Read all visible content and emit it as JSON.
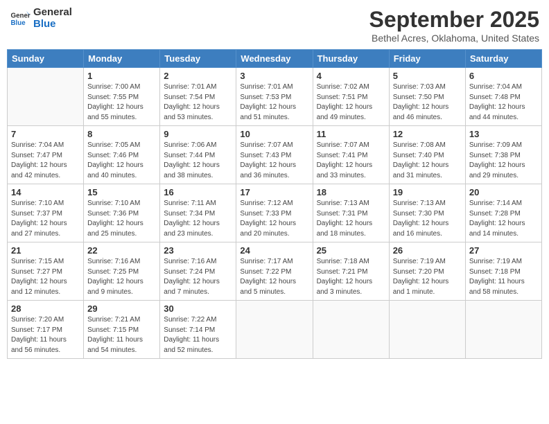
{
  "logo": {
    "line1": "General",
    "line2": "Blue"
  },
  "title": "September 2025",
  "location": "Bethel Acres, Oklahoma, United States",
  "days_of_week": [
    "Sunday",
    "Monday",
    "Tuesday",
    "Wednesday",
    "Thursday",
    "Friday",
    "Saturday"
  ],
  "weeks": [
    [
      {
        "day": "",
        "info": ""
      },
      {
        "day": "1",
        "info": "Sunrise: 7:00 AM\nSunset: 7:55 PM\nDaylight: 12 hours\nand 55 minutes."
      },
      {
        "day": "2",
        "info": "Sunrise: 7:01 AM\nSunset: 7:54 PM\nDaylight: 12 hours\nand 53 minutes."
      },
      {
        "day": "3",
        "info": "Sunrise: 7:01 AM\nSunset: 7:53 PM\nDaylight: 12 hours\nand 51 minutes."
      },
      {
        "day": "4",
        "info": "Sunrise: 7:02 AM\nSunset: 7:51 PM\nDaylight: 12 hours\nand 49 minutes."
      },
      {
        "day": "5",
        "info": "Sunrise: 7:03 AM\nSunset: 7:50 PM\nDaylight: 12 hours\nand 46 minutes."
      },
      {
        "day": "6",
        "info": "Sunrise: 7:04 AM\nSunset: 7:48 PM\nDaylight: 12 hours\nand 44 minutes."
      }
    ],
    [
      {
        "day": "7",
        "info": "Sunrise: 7:04 AM\nSunset: 7:47 PM\nDaylight: 12 hours\nand 42 minutes."
      },
      {
        "day": "8",
        "info": "Sunrise: 7:05 AM\nSunset: 7:46 PM\nDaylight: 12 hours\nand 40 minutes."
      },
      {
        "day": "9",
        "info": "Sunrise: 7:06 AM\nSunset: 7:44 PM\nDaylight: 12 hours\nand 38 minutes."
      },
      {
        "day": "10",
        "info": "Sunrise: 7:07 AM\nSunset: 7:43 PM\nDaylight: 12 hours\nand 36 minutes."
      },
      {
        "day": "11",
        "info": "Sunrise: 7:07 AM\nSunset: 7:41 PM\nDaylight: 12 hours\nand 33 minutes."
      },
      {
        "day": "12",
        "info": "Sunrise: 7:08 AM\nSunset: 7:40 PM\nDaylight: 12 hours\nand 31 minutes."
      },
      {
        "day": "13",
        "info": "Sunrise: 7:09 AM\nSunset: 7:38 PM\nDaylight: 12 hours\nand 29 minutes."
      }
    ],
    [
      {
        "day": "14",
        "info": "Sunrise: 7:10 AM\nSunset: 7:37 PM\nDaylight: 12 hours\nand 27 minutes."
      },
      {
        "day": "15",
        "info": "Sunrise: 7:10 AM\nSunset: 7:36 PM\nDaylight: 12 hours\nand 25 minutes."
      },
      {
        "day": "16",
        "info": "Sunrise: 7:11 AM\nSunset: 7:34 PM\nDaylight: 12 hours\nand 23 minutes."
      },
      {
        "day": "17",
        "info": "Sunrise: 7:12 AM\nSunset: 7:33 PM\nDaylight: 12 hours\nand 20 minutes."
      },
      {
        "day": "18",
        "info": "Sunrise: 7:13 AM\nSunset: 7:31 PM\nDaylight: 12 hours\nand 18 minutes."
      },
      {
        "day": "19",
        "info": "Sunrise: 7:13 AM\nSunset: 7:30 PM\nDaylight: 12 hours\nand 16 minutes."
      },
      {
        "day": "20",
        "info": "Sunrise: 7:14 AM\nSunset: 7:28 PM\nDaylight: 12 hours\nand 14 minutes."
      }
    ],
    [
      {
        "day": "21",
        "info": "Sunrise: 7:15 AM\nSunset: 7:27 PM\nDaylight: 12 hours\nand 12 minutes."
      },
      {
        "day": "22",
        "info": "Sunrise: 7:16 AM\nSunset: 7:25 PM\nDaylight: 12 hours\nand 9 minutes."
      },
      {
        "day": "23",
        "info": "Sunrise: 7:16 AM\nSunset: 7:24 PM\nDaylight: 12 hours\nand 7 minutes."
      },
      {
        "day": "24",
        "info": "Sunrise: 7:17 AM\nSunset: 7:22 PM\nDaylight: 12 hours\nand 5 minutes."
      },
      {
        "day": "25",
        "info": "Sunrise: 7:18 AM\nSunset: 7:21 PM\nDaylight: 12 hours\nand 3 minutes."
      },
      {
        "day": "26",
        "info": "Sunrise: 7:19 AM\nSunset: 7:20 PM\nDaylight: 12 hours\nand 1 minute."
      },
      {
        "day": "27",
        "info": "Sunrise: 7:19 AM\nSunset: 7:18 PM\nDaylight: 11 hours\nand 58 minutes."
      }
    ],
    [
      {
        "day": "28",
        "info": "Sunrise: 7:20 AM\nSunset: 7:17 PM\nDaylight: 11 hours\nand 56 minutes."
      },
      {
        "day": "29",
        "info": "Sunrise: 7:21 AM\nSunset: 7:15 PM\nDaylight: 11 hours\nand 54 minutes."
      },
      {
        "day": "30",
        "info": "Sunrise: 7:22 AM\nSunset: 7:14 PM\nDaylight: 11 hours\nand 52 minutes."
      },
      {
        "day": "",
        "info": ""
      },
      {
        "day": "",
        "info": ""
      },
      {
        "day": "",
        "info": ""
      },
      {
        "day": "",
        "info": ""
      }
    ]
  ]
}
